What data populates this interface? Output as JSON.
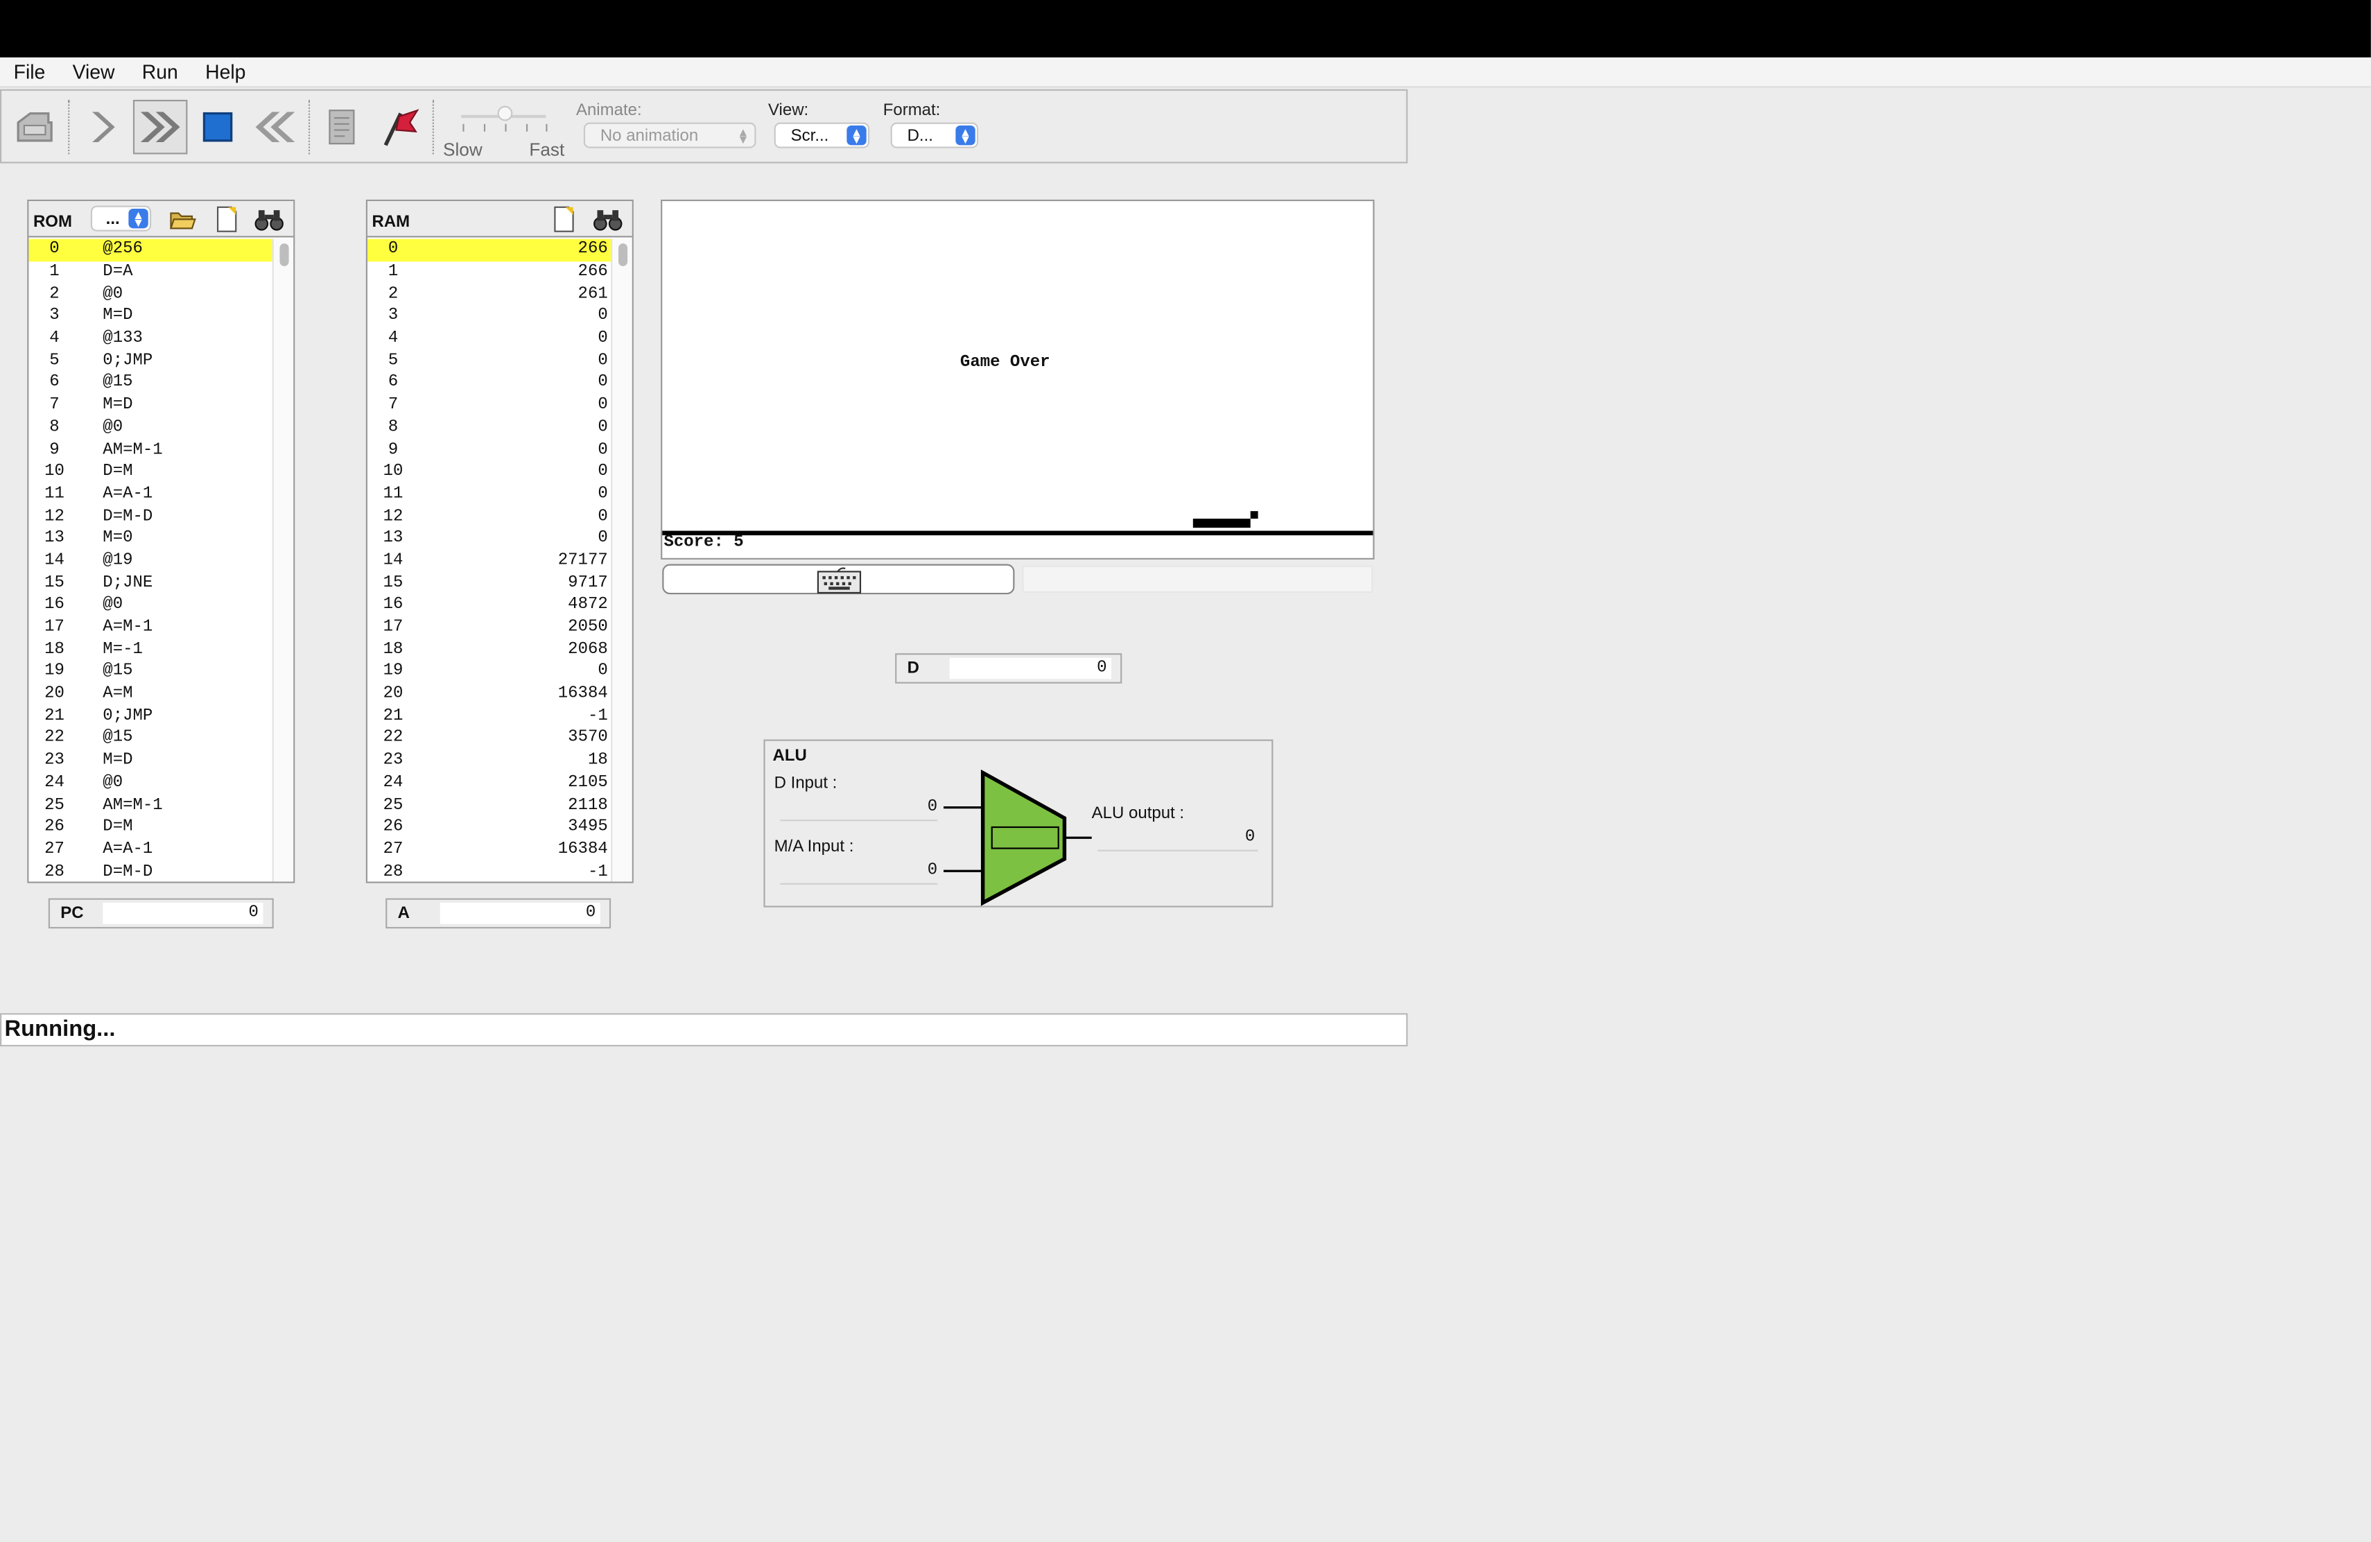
{
  "menu": [
    "File",
    "View",
    "Run",
    "Help"
  ],
  "toolbar": {
    "speed_slow": "Slow",
    "speed_fast": "Fast",
    "animate_label": "Animate:",
    "animate_value": "No animation",
    "view_label": "View:",
    "view_value": "Scr...",
    "format_label": "Format:",
    "format_value": "D..."
  },
  "rom": {
    "title": "ROM",
    "mode_value": "...",
    "rows": [
      {
        "addr": "0",
        "ins": "@256"
      },
      {
        "addr": "1",
        "ins": "D=A"
      },
      {
        "addr": "2",
        "ins": "@0"
      },
      {
        "addr": "3",
        "ins": "M=D"
      },
      {
        "addr": "4",
        "ins": "@133"
      },
      {
        "addr": "5",
        "ins": "0;JMP"
      },
      {
        "addr": "6",
        "ins": "@15"
      },
      {
        "addr": "7",
        "ins": "M=D"
      },
      {
        "addr": "8",
        "ins": "@0"
      },
      {
        "addr": "9",
        "ins": "AM=M-1"
      },
      {
        "addr": "10",
        "ins": "D=M"
      },
      {
        "addr": "11",
        "ins": "A=A-1"
      },
      {
        "addr": "12",
        "ins": "D=M-D"
      },
      {
        "addr": "13",
        "ins": "M=0"
      },
      {
        "addr": "14",
        "ins": "@19"
      },
      {
        "addr": "15",
        "ins": "D;JNE"
      },
      {
        "addr": "16",
        "ins": "@0"
      },
      {
        "addr": "17",
        "ins": "A=M-1"
      },
      {
        "addr": "18",
        "ins": "M=-1"
      },
      {
        "addr": "19",
        "ins": "@15"
      },
      {
        "addr": "20",
        "ins": "A=M"
      },
      {
        "addr": "21",
        "ins": "0;JMP"
      },
      {
        "addr": "22",
        "ins": "@15"
      },
      {
        "addr": "23",
        "ins": "M=D"
      },
      {
        "addr": "24",
        "ins": "@0"
      },
      {
        "addr": "25",
        "ins": "AM=M-1"
      },
      {
        "addr": "26",
        "ins": "D=M"
      },
      {
        "addr": "27",
        "ins": "A=A-1"
      },
      {
        "addr": "28",
        "ins": "D=M-D"
      }
    ]
  },
  "ram": {
    "title": "RAM",
    "rows": [
      {
        "addr": "0",
        "val": "266"
      },
      {
        "addr": "1",
        "val": "266"
      },
      {
        "addr": "2",
        "val": "261"
      },
      {
        "addr": "3",
        "val": "0"
      },
      {
        "addr": "4",
        "val": "0"
      },
      {
        "addr": "5",
        "val": "0"
      },
      {
        "addr": "6",
        "val": "0"
      },
      {
        "addr": "7",
        "val": "0"
      },
      {
        "addr": "8",
        "val": "0"
      },
      {
        "addr": "9",
        "val": "0"
      },
      {
        "addr": "10",
        "val": "0"
      },
      {
        "addr": "11",
        "val": "0"
      },
      {
        "addr": "12",
        "val": "0"
      },
      {
        "addr": "13",
        "val": "0"
      },
      {
        "addr": "14",
        "val": "27177"
      },
      {
        "addr": "15",
        "val": "9717"
      },
      {
        "addr": "16",
        "val": "4872"
      },
      {
        "addr": "17",
        "val": "2050"
      },
      {
        "addr": "18",
        "val": "2068"
      },
      {
        "addr": "19",
        "val": "0"
      },
      {
        "addr": "20",
        "val": "16384"
      },
      {
        "addr": "21",
        "val": "-1"
      },
      {
        "addr": "22",
        "val": "3570"
      },
      {
        "addr": "23",
        "val": "18"
      },
      {
        "addr": "24",
        "val": "2105"
      },
      {
        "addr": "25",
        "val": "2118"
      },
      {
        "addr": "26",
        "val": "3495"
      },
      {
        "addr": "27",
        "val": "16384"
      },
      {
        "addr": "28",
        "val": "-1"
      }
    ]
  },
  "registers": {
    "pc_label": "PC",
    "pc_value": "0",
    "a_label": "A",
    "a_value": "0",
    "d_label": "D",
    "d_value": "0"
  },
  "screen": {
    "message": "Game Over",
    "score": "Score: 5"
  },
  "alu": {
    "title": "ALU",
    "d_input_label": "D Input :",
    "d_input_value": "0",
    "ma_input_label": "M/A Input :",
    "ma_input_value": "0",
    "output_label": "ALU output :",
    "output_value": "0",
    "fill_color": "#7dc142"
  },
  "status": "Running...",
  "colors": {
    "highlight": "#ffff40",
    "accent": "#3a7bea"
  }
}
